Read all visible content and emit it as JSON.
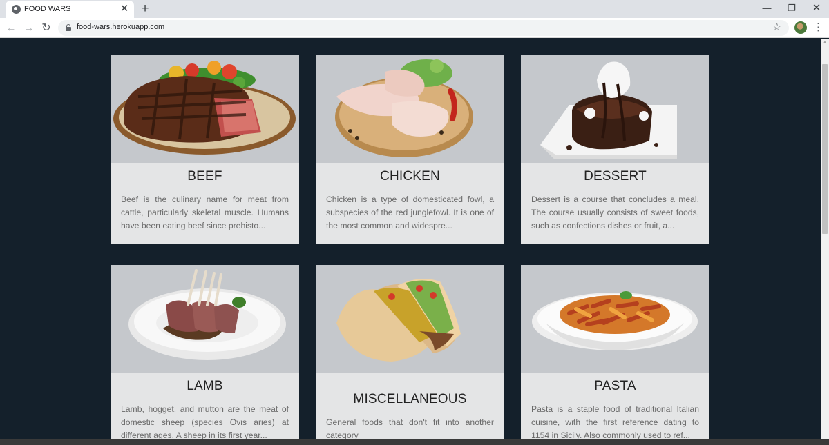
{
  "browser": {
    "tab_title": "FOOD WARS",
    "new_tab_symbol": "+",
    "url": "food-wars.herokuapp.com"
  },
  "categories": [
    {
      "title": "BEEF",
      "description": "Beef is the culinary name for meat from cattle, particularly skeletal muscle. Humans have been eating beef since prehisto...",
      "image": "grilled-steak-plate"
    },
    {
      "title": "CHICKEN",
      "description": "Chicken is a type of domesticated fowl, a subspecies of the red junglefowl. It is one of the most common and widespre...",
      "image": "raw-chicken-legs-board"
    },
    {
      "title": "DESSERT",
      "description": "Dessert is a course that concludes a meal. The course usually consists of sweet foods, such as confections dishes or fruit, a...",
      "image": "chocolate-cake-plate"
    },
    {
      "title": "LAMB",
      "description": "Lamb, hogget, and mutton are the meat of domestic sheep (species Ovis aries) at different ages. A sheep in its first year...",
      "image": "lamb-chops-plate"
    },
    {
      "title": "MISCELLANEOUS",
      "description": "General foods that don't fit into another category",
      "image": "tacos"
    },
    {
      "title": "PASTA",
      "description": "Pasta is a staple food of traditional Italian cuisine, with the first reference dating to 1154 in Sicily. Also commonly used to ref...",
      "image": "penne-pasta-plate"
    }
  ],
  "colors": {
    "page_background": "#14202b",
    "card_background": "#e4e5e6",
    "image_background": "#c5c8cc"
  }
}
